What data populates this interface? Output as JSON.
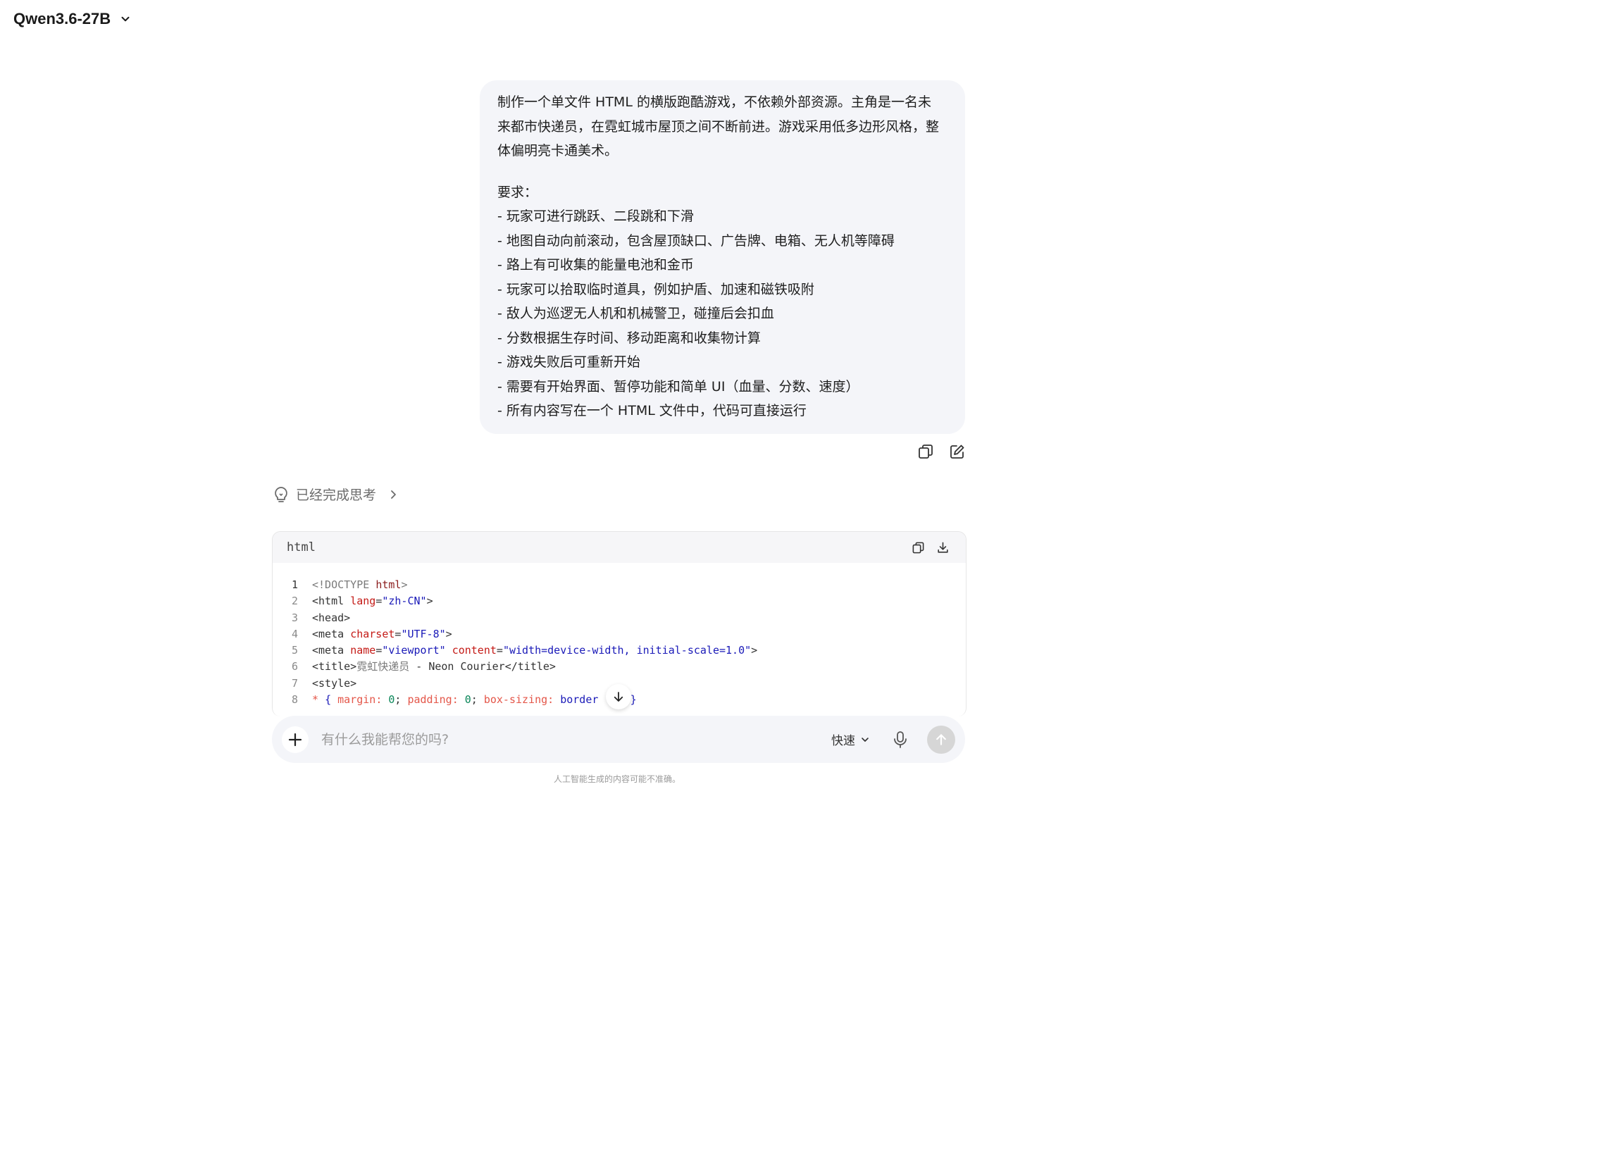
{
  "header": {
    "model_name": "Qwen3.6-27B"
  },
  "user_message": {
    "lines": [
      "制作一个单文件 HTML 的横版跑酷游戏，不依赖外部资源。主角是一名未",
      "来都市快递员，在霓虹城市屋顶之间不断前进。游戏采用低多边形风格，整",
      "体偏明亮卡通美术。",
      "要求：",
      "- 玩家可进行跳跃、二段跳和下滑",
      "- 地图自动向前滚动，包含屋顶缺口、广告牌、电箱、无人机等障碍",
      "- 路上有可收集的能量电池和金币",
      "- 玩家可以拾取临时道具，例如护盾、加速和磁铁吸附",
      "- 敌人为巡逻无人机和机械警卫，碰撞后会扣血",
      "- 分数根据生存时间、移动距离和收集物计算",
      "- 游戏失败后可重新开始",
      "- 需要有开始界面、暂停功能和简单 UI（血量、分数、速度）",
      "- 所有内容写在一个 HTML 文件中，代码可直接运行"
    ]
  },
  "thinking": {
    "label": "已经完成思考"
  },
  "code_block": {
    "language": "html",
    "lines": [
      {
        "num": "1",
        "tokens": [
          [
            "p",
            "<!DOCTYPE "
          ],
          [
            "tag",
            "html"
          ],
          [
            "p",
            ">"
          ]
        ]
      },
      {
        "num": "2",
        "tokens": [
          [
            "t",
            "<html "
          ],
          [
            "attr",
            "lang"
          ],
          [
            "t",
            "="
          ],
          [
            "str",
            "\"zh-CN\""
          ],
          [
            "t",
            ">"
          ]
        ]
      },
      {
        "num": "3",
        "tokens": [
          [
            "t",
            "<head>"
          ]
        ]
      },
      {
        "num": "4",
        "tokens": [
          [
            "t",
            "<meta "
          ],
          [
            "attr",
            "charset"
          ],
          [
            "t",
            "="
          ],
          [
            "str",
            "\"UTF-8\""
          ],
          [
            "t",
            ">"
          ]
        ]
      },
      {
        "num": "5",
        "tokens": [
          [
            "t",
            "<meta "
          ],
          [
            "attr",
            "name"
          ],
          [
            "t",
            "="
          ],
          [
            "str",
            "\"viewport\""
          ],
          [
            "t",
            " "
          ],
          [
            "attr",
            "content"
          ],
          [
            "t",
            "="
          ],
          [
            "str",
            "\"width=device-width, initial-scale=1.0\""
          ],
          [
            "t",
            ">"
          ]
        ]
      },
      {
        "num": "6",
        "tokens": [
          [
            "t",
            "<title>"
          ],
          [
            "p",
            "霓虹快递员"
          ],
          [
            "t",
            " - Neon Courier</title>"
          ]
        ]
      },
      {
        "num": "7",
        "tokens": [
          [
            "t",
            "<style>"
          ]
        ]
      },
      {
        "num": "8",
        "tokens": [
          [
            "prop",
            "* "
          ],
          [
            "str",
            "{ "
          ],
          [
            "prop",
            "margin"
          ],
          [
            "prop",
            ":"
          ],
          [
            "t",
            " "
          ],
          [
            "num",
            "0"
          ],
          [
            "t",
            "; "
          ],
          [
            "prop",
            "padding"
          ],
          [
            "prop",
            ":"
          ],
          [
            "t",
            " "
          ],
          [
            "num",
            "0"
          ],
          [
            "t",
            "; "
          ],
          [
            "prop",
            "box-sizing"
          ],
          [
            "prop",
            ":"
          ],
          [
            "t",
            " "
          ],
          [
            "str",
            "border"
          ],
          [
            "t",
            "   ; "
          ],
          [
            "str",
            "}"
          ]
        ]
      }
    ]
  },
  "composer": {
    "placeholder": "有什么我能帮您的吗?",
    "mode_label": "快速"
  },
  "footer": {
    "disclaimer": "人工智能生成的内容可能不准确。"
  }
}
